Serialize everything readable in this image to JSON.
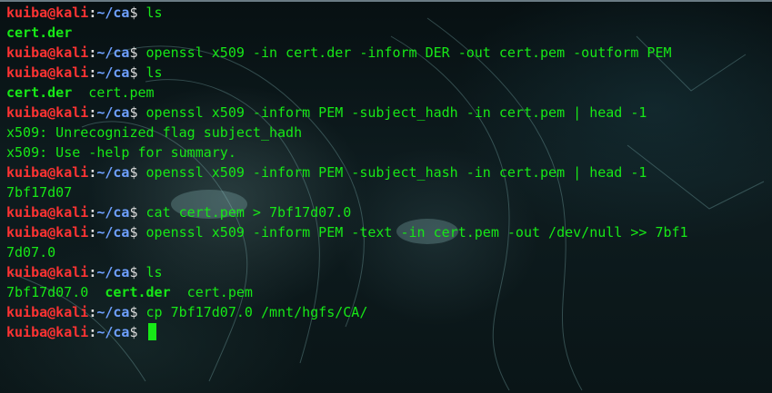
{
  "prompt": {
    "user": "kuiba@kali",
    "colon": ":",
    "path": "~/ca",
    "symbol": "$ "
  },
  "lines": [
    {
      "type": "prompt",
      "cmd": "ls"
    },
    {
      "type": "output",
      "segments": [
        {
          "text": "cert.der",
          "bold": true
        }
      ]
    },
    {
      "type": "prompt",
      "cmd": "openssl x509 -in cert.der -inform DER -out cert.pem -outform PEM"
    },
    {
      "type": "prompt",
      "cmd": "ls"
    },
    {
      "type": "output",
      "segments": [
        {
          "text": "cert.der",
          "bold": true
        },
        {
          "text": "  cert.pem",
          "bold": false
        }
      ]
    },
    {
      "type": "prompt",
      "cmd": "openssl x509 -inform PEM -subject_hadh -in cert.pem | head -1"
    },
    {
      "type": "output",
      "segments": [
        {
          "text": "x509: Unrecognized flag subject_hadh",
          "bold": false
        }
      ]
    },
    {
      "type": "output",
      "segments": [
        {
          "text": "x509: Use -help for summary.",
          "bold": false
        }
      ]
    },
    {
      "type": "prompt",
      "cmd": "openssl x509 -inform PEM -subject_hash -in cert.pem | head -1"
    },
    {
      "type": "output",
      "segments": [
        {
          "text": "7bf17d07",
          "bold": false
        }
      ]
    },
    {
      "type": "prompt",
      "cmd": "cat cert.pem > 7bf17d07.0"
    },
    {
      "type": "prompt",
      "cmd": "openssl x509 -inform PEM -text -in cert.pem -out /dev/null >> 7bf1"
    },
    {
      "type": "output",
      "segments": [
        {
          "text": "7d07.0",
          "bold": false
        }
      ]
    },
    {
      "type": "prompt",
      "cmd": "ls"
    },
    {
      "type": "output",
      "segments": [
        {
          "text": "7bf17d07.0  ",
          "bold": false
        },
        {
          "text": "cert.der",
          "bold": true
        },
        {
          "text": "  cert.pem",
          "bold": false
        }
      ]
    },
    {
      "type": "prompt",
      "cmd": "cp 7bf17d07.0 /mnt/hgfs/CA/"
    },
    {
      "type": "prompt",
      "cmd": "",
      "cursor": true
    }
  ],
  "colors": {
    "user": "#ff3333",
    "path": "#6ea0ff",
    "text": "#17e817",
    "cursor": "#17e817"
  }
}
